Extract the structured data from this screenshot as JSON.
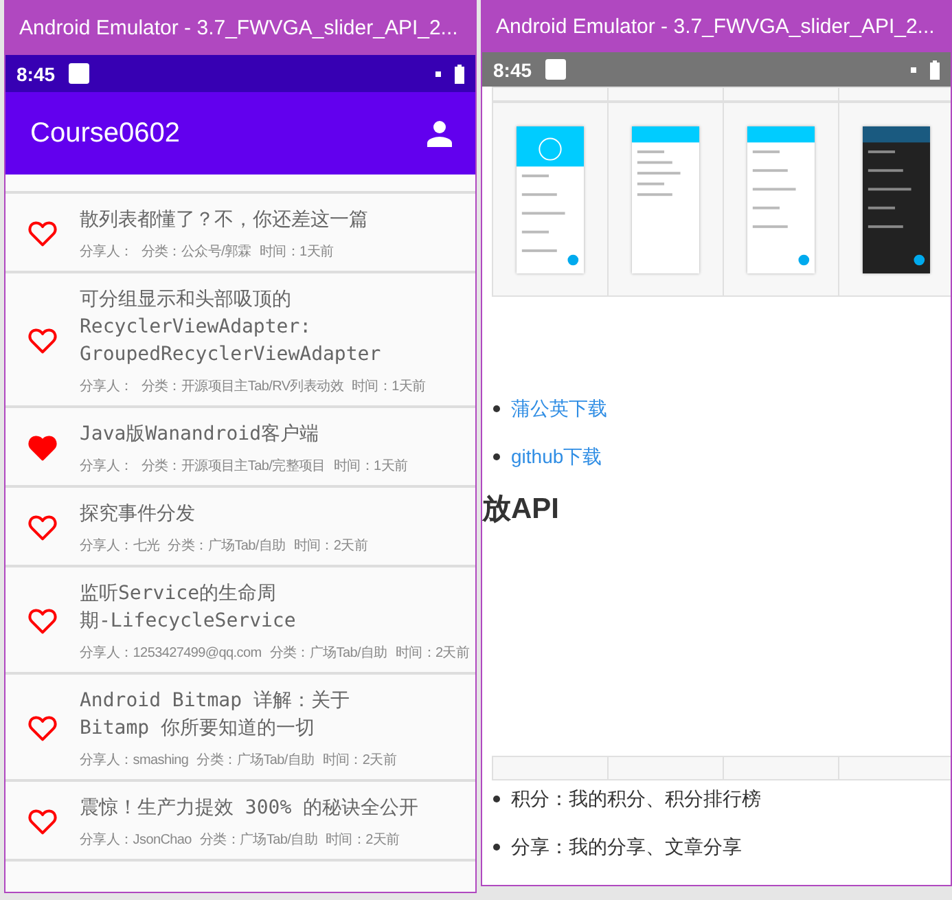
{
  "left_window": {
    "title": "Android Emulator - 3.7_FWVGA_slider_API_2...",
    "status_bar": {
      "time": "8:45"
    },
    "app_bar": {
      "title": "Course0602"
    },
    "articles": [
      {
        "title": [
          "散列表都懂了？不，你还差这一篇"
        ],
        "sharer": "分享人：",
        "category": "分类：公众号/郭霖",
        "time": "时间：1天前",
        "liked": false
      },
      {
        "title": [
          "可分组显示和头部吸顶的",
          "RecyclerViewAdapter:",
          "GroupedRecyclerViewAdapter"
        ],
        "sharer": "分享人：",
        "category": "分类：开源项目主Tab/RV列表动效",
        "time": "时间：1天前",
        "liked": false
      },
      {
        "title": [
          "Java版Wanandroid客户端"
        ],
        "sharer": "分享人：",
        "category": "分类：开源项目主Tab/完整项目",
        "time": "时间：1天前",
        "liked": true
      },
      {
        "title": [
          "探究事件分发"
        ],
        "sharer": "分享人：七光",
        "category": "分类：广场Tab/自助",
        "time": "时间：2天前",
        "liked": false
      },
      {
        "title": [
          "监听Service的生命周",
          "期-LifecycleService"
        ],
        "sharer": "分享人：1253427499@qq.com",
        "category": "分类：广场Tab/自助",
        "time": "时间：2天前",
        "liked": false
      },
      {
        "title": [
          "Android Bitmap 详解：关于",
          "Bitamp 你所要知道的一切"
        ],
        "sharer": "分享人：smashing",
        "category": "分类：广场Tab/自助",
        "time": "时间：2天前",
        "liked": false
      },
      {
        "title": [
          "震惊！生产力提效 300% 的秘诀全公开"
        ],
        "sharer": "分享人：JsonChao",
        "category": "分类：广场Tab/自助",
        "time": "时间：2天前",
        "liked": false
      }
    ]
  },
  "right_window": {
    "title": "Android Emulator - 3.7_FWVGA_slider_API_2...",
    "status_bar": {
      "time": "8:45"
    },
    "screenshots": [
      {
        "kind": "picture"
      },
      {
        "kind": "picture"
      },
      {
        "kind": "picture"
      },
      {
        "kind": "picture"
      }
    ],
    "links": [
      "蒲公英下载",
      "github下载"
    ],
    "heading": "放API",
    "bullets": [
      "积分：我的积分、积分排行榜",
      "分享：我的分享、文章分享"
    ]
  }
}
